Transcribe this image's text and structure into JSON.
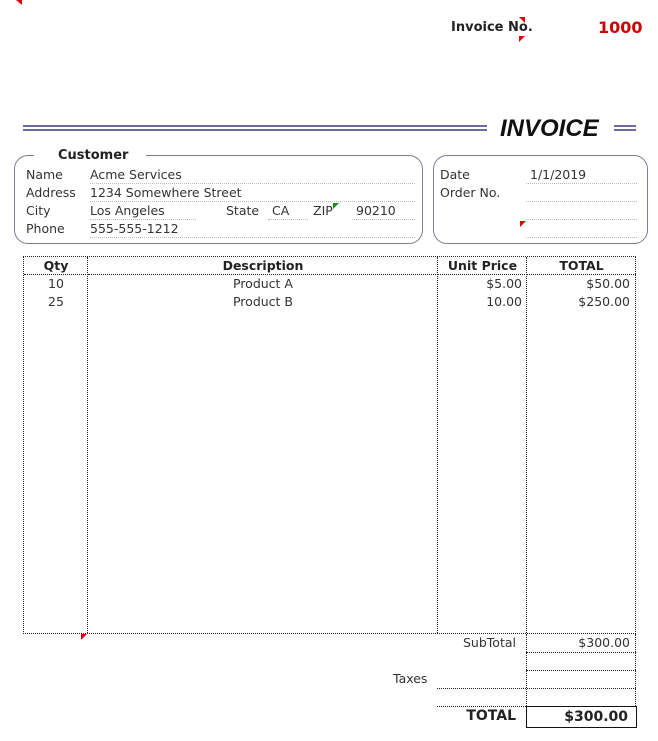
{
  "header": {
    "invoice_no_label": "Invoice No.",
    "invoice_no": "1000",
    "title": "INVOICE"
  },
  "customer": {
    "legend": "Customer",
    "name_label": "Name",
    "name": "Acme Services",
    "address_label": "Address",
    "address": "1234 Somewhere Street",
    "city_label": "City",
    "city": "Los Angeles",
    "state_label": "State",
    "state": "CA",
    "zip_label": "ZIP",
    "zip": "90210",
    "phone_label": "Phone",
    "phone": "555-555-1212"
  },
  "order": {
    "date_label": "Date",
    "date": "1/1/2019",
    "order_no_label": "Order No.",
    "order_no": ""
  },
  "table": {
    "headers": {
      "qty": "Qty",
      "description": "Description",
      "unit_price": "Unit Price",
      "total": "TOTAL"
    },
    "rows": [
      {
        "qty": "10",
        "description": "Product A",
        "unit_price": "$5.00",
        "total": "$50.00"
      },
      {
        "qty": "25",
        "description": "Product B",
        "unit_price": "10.00",
        "total": "$250.00"
      }
    ]
  },
  "summary": {
    "subtotal_label": "SubTotal",
    "subtotal": "$300.00",
    "taxes_label": "Taxes",
    "total_label": "TOTAL",
    "total": "$300.00"
  },
  "colors": {
    "accent_red": "#d00000",
    "rule": "#6b6b9a"
  }
}
